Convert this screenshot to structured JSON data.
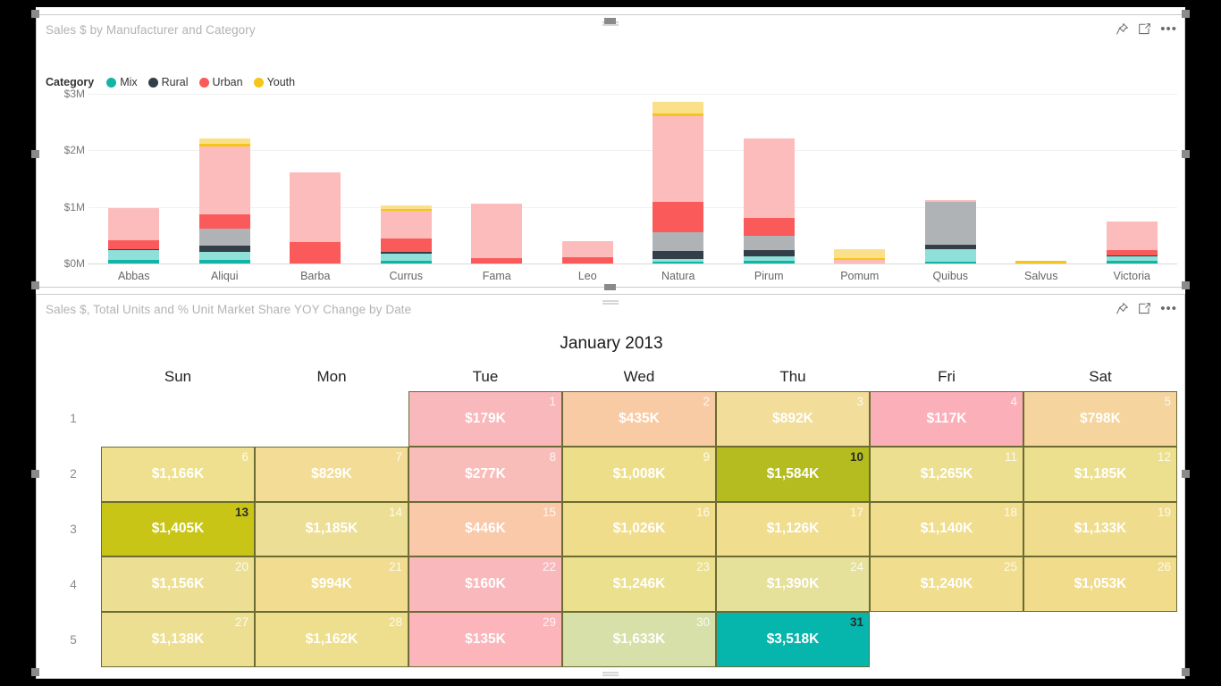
{
  "bar_visual": {
    "title": "Sales $ by Manufacturer and Category",
    "icons": {
      "pin": "pin-icon",
      "focus": "focus-mode-icon",
      "more": "more-options-icon"
    },
    "legend": {
      "title": "Category",
      "items": [
        {
          "label": "Mix",
          "color": "#12b5a5"
        },
        {
          "label": "Rural",
          "color": "#333f48"
        },
        {
          "label": "Urban",
          "color": "#fb5a5a"
        },
        {
          "label": "Youth",
          "color": "#f5c518"
        }
      ]
    }
  },
  "chart_data": [
    {
      "type": "bar",
      "title": "Sales $ by Manufacturer and Category",
      "xlabel": "",
      "ylabel": "",
      "ylim": [
        0,
        3000000
      ],
      "yticks": [
        "$0M",
        "$1M",
        "$2M",
        "$3M"
      ],
      "grid": true,
      "legend_position": "top",
      "stacked": true,
      "categories": [
        "Abbas",
        "Aliqui",
        "Barba",
        "Currus",
        "Fama",
        "Leo",
        "Natura",
        "Pirum",
        "Pomum",
        "Quibus",
        "Salvus",
        "Victoria"
      ],
      "series": [
        {
          "name": "Mix",
          "color": "#12b5a5",
          "values": [
            60000,
            60000,
            0,
            55000,
            0,
            0,
            30000,
            40000,
            0,
            25000,
            0,
            55000
          ]
        },
        {
          "name": "Mix light",
          "color": "#8ee0d8",
          "values": [
            175000,
            150000,
            0,
            120000,
            0,
            0,
            50000,
            90000,
            0,
            225000,
            0,
            70000
          ]
        },
        {
          "name": "Rural",
          "color": "#333f48",
          "values": [
            15000,
            105000,
            0,
            35000,
            0,
            0,
            135000,
            110000,
            0,
            75000,
            0,
            15000
          ]
        },
        {
          "name": "Rural light",
          "color": "#b0b3b5",
          "values": [
            0,
            300000,
            0,
            0,
            0,
            0,
            345000,
            245000,
            0,
            760000,
            0,
            0
          ]
        },
        {
          "name": "Urban",
          "color": "#fb5a5a",
          "values": [
            160000,
            250000,
            385000,
            230000,
            100000,
            110000,
            525000,
            320000,
            0,
            0,
            0,
            100000
          ]
        },
        {
          "name": "Urban light",
          "color": "#fcbcbc",
          "values": [
            570000,
            1200000,
            1220000,
            490000,
            965000,
            290000,
            1525000,
            1410000,
            65000,
            30000,
            0,
            500000
          ]
        },
        {
          "name": "Youth",
          "color": "#f5c518",
          "values": [
            0,
            45000,
            0,
            35000,
            0,
            0,
            45000,
            0,
            25000,
            0,
            50000,
            0
          ]
        },
        {
          "name": "Youth light",
          "color": "#fbe08a",
          "values": [
            0,
            100000,
            0,
            60000,
            0,
            0,
            200000,
            0,
            160000,
            0,
            0,
            0
          ]
        }
      ]
    },
    {
      "type": "heatmap",
      "title": "Sales $, Total Units and % Unit Market Share YOY Change by Date",
      "month": "January 2013",
      "day_headers": [
        "Sun",
        "Mon",
        "Tue",
        "Wed",
        "Thu",
        "Fri",
        "Sat"
      ],
      "row_labels": [
        "1",
        "2",
        "3",
        "4",
        "5"
      ],
      "cells": [
        [
          null,
          null,
          {
            "day": "1",
            "value": "$179K",
            "color": "#f9b8bb",
            "dark": false
          },
          {
            "day": "2",
            "value": "$435K",
            "color": "#f8cba4",
            "dark": false
          },
          {
            "day": "3",
            "value": "$892K",
            "color": "#f2dd9a",
            "dark": false
          },
          {
            "day": "4",
            "value": "$117K",
            "color": "#fbafb9",
            "dark": false
          },
          {
            "day": "5",
            "value": "$798K",
            "color": "#f5d49e",
            "dark": false
          }
        ],
        [
          {
            "day": "6",
            "value": "$1,166K",
            "color": "#eee08e",
            "dark": false
          },
          {
            "day": "7",
            "value": "$829K",
            "color": "#f3dc95",
            "dark": false
          },
          {
            "day": "8",
            "value": "$277K",
            "color": "#f9bdb9",
            "dark": false
          },
          {
            "day": "9",
            "value": "$1,008K",
            "color": "#eddf8a",
            "dark": false
          },
          {
            "day": "10",
            "value": "$1,584K",
            "color": "#b5bc1f",
            "dark": true
          },
          {
            "day": "11",
            "value": "$1,265K",
            "color": "#ecdf90",
            "dark": false
          },
          {
            "day": "12",
            "value": "$1,185K",
            "color": "#ecdf8e",
            "dark": false
          }
        ],
        [
          {
            "day": "13",
            "value": "$1,405K",
            "color": "#c8c516",
            "dark": true
          },
          {
            "day": "14",
            "value": "$1,185K",
            "color": "#ecdf95",
            "dark": false
          },
          {
            "day": "15",
            "value": "$446K",
            "color": "#f9c9a9",
            "dark": false
          },
          {
            "day": "16",
            "value": "$1,026K",
            "color": "#f0dd8c",
            "dark": false
          },
          {
            "day": "17",
            "value": "$1,126K",
            "color": "#f0de8e",
            "dark": false
          },
          {
            "day": "18",
            "value": "$1,140K",
            "color": "#f0de8e",
            "dark": false
          },
          {
            "day": "19",
            "value": "$1,133K",
            "color": "#efdd8d",
            "dark": false
          }
        ],
        [
          {
            "day": "20",
            "value": "$1,156K",
            "color": "#ecdf94",
            "dark": false
          },
          {
            "day": "21",
            "value": "$994K",
            "color": "#f1dc90",
            "dark": false
          },
          {
            "day": "22",
            "value": "$160K",
            "color": "#f9b8bb",
            "dark": false
          },
          {
            "day": "23",
            "value": "$1,246K",
            "color": "#eae08d",
            "dark": false
          },
          {
            "day": "24",
            "value": "$1,390K",
            "color": "#e5e09a",
            "dark": false
          },
          {
            "day": "25",
            "value": "$1,240K",
            "color": "#f0dd8d",
            "dark": false
          },
          {
            "day": "26",
            "value": "$1,053K",
            "color": "#f1dc8c",
            "dark": false
          }
        ],
        [
          {
            "day": "27",
            "value": "$1,138K",
            "color": "#eddf92",
            "dark": false
          },
          {
            "day": "28",
            "value": "$1,162K",
            "color": "#eddf8e",
            "dark": false
          },
          {
            "day": "29",
            "value": "$135K",
            "color": "#fbb5bb",
            "dark": false
          },
          {
            "day": "30",
            "value": "$1,633K",
            "color": "#d6e0a8",
            "dark": false
          },
          {
            "day": "31",
            "value": "$3,518K",
            "color": "#06b5ab",
            "dark": true
          },
          null,
          null
        ]
      ]
    }
  ],
  "calendar_visual": {
    "title": "Sales $, Total Units and % Unit Market Share YOY Change by Date",
    "icons": {
      "pin": "pin-icon",
      "focus": "focus-mode-icon",
      "more": "more-options-icon"
    }
  }
}
